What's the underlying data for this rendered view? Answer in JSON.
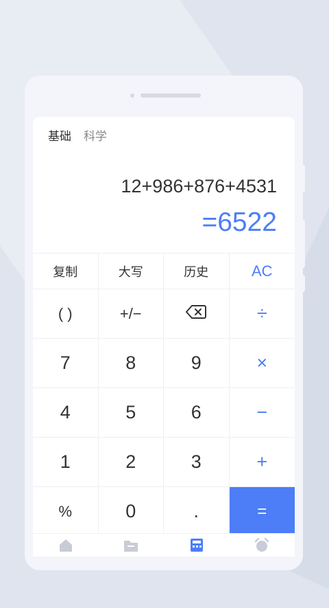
{
  "mode_tabs": [
    {
      "label": "基础",
      "active": true
    },
    {
      "label": "科学",
      "active": false
    }
  ],
  "display": {
    "expression": "12+986+876+4531",
    "result": "=6522"
  },
  "keypad": {
    "copy": "复制",
    "uppercase": "大写",
    "history": "历史",
    "clear": "AC",
    "parentheses": "( )",
    "plus_minus": "+/−",
    "divide": "÷",
    "seven": "7",
    "eight": "8",
    "nine": "9",
    "multiply": "×",
    "four": "4",
    "five": "5",
    "six": "6",
    "minus": "−",
    "one": "1",
    "two": "2",
    "three": "3",
    "plus": "+",
    "percent": "%",
    "zero": "0",
    "dot": ".",
    "equals": "="
  },
  "bottom_nav": [
    {
      "icon": "home-icon",
      "active": false
    },
    {
      "icon": "folder-icon",
      "active": false
    },
    {
      "icon": "calculator-icon",
      "active": true
    },
    {
      "icon": "alarm-clock-icon",
      "active": false
    }
  ],
  "colors": {
    "accent": "#4d7ef7",
    "background": "#dfe4ee",
    "text": "#333333",
    "muted": "#888888"
  }
}
